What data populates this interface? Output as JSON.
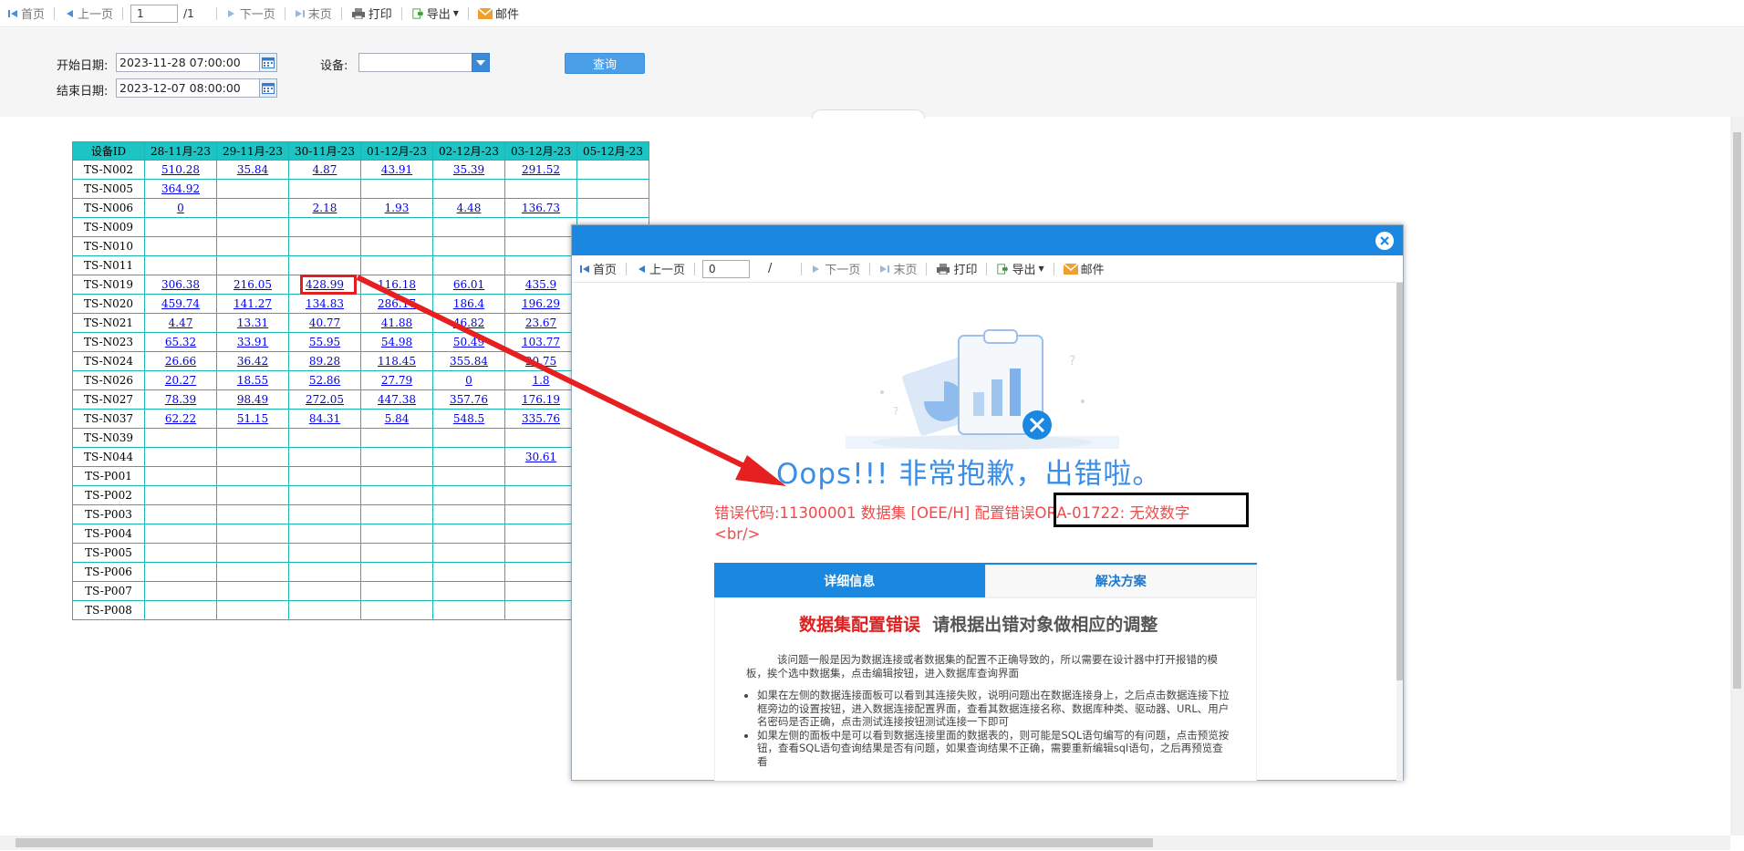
{
  "toolbar": {
    "first": "首页",
    "prev": "上一页",
    "page_value": "1",
    "page_total": "/1",
    "next": "下一页",
    "last": "末页",
    "print": "打印",
    "export": "导出",
    "mail": "邮件"
  },
  "filter": {
    "start_label": "开始日期:",
    "start_value": "2023-11-28 07:00:00",
    "end_label": "结束日期:",
    "end_value": "2023-12-07 08:00:00",
    "device_label": "设备:",
    "device_value": "",
    "query_button": "查询"
  },
  "table": {
    "headers": [
      "设备ID",
      "28-11月-23",
      "29-11月-23",
      "30-11月-23",
      "01-12月-23",
      "02-12月-23",
      "03-12月-23",
      "05-12月-23"
    ],
    "rows": [
      [
        "TS-N002",
        "510.28",
        "35.84",
        "4.87",
        "43.91",
        "35.39",
        "291.52",
        ""
      ],
      [
        "TS-N005",
        "364.92",
        "",
        "",
        "",
        "",
        "",
        ""
      ],
      [
        "TS-N006",
        "0",
        "",
        "2.18",
        "1.93",
        "4.48",
        "136.73",
        ""
      ],
      [
        "TS-N009",
        "",
        "",
        "",
        "",
        "",
        "",
        ""
      ],
      [
        "TS-N010",
        "",
        "",
        "",
        "",
        "",
        "",
        ""
      ],
      [
        "TS-N011",
        "",
        "",
        "",
        "",
        "",
        "",
        ""
      ],
      [
        "TS-N019",
        "306.38",
        "216.05",
        "428.99",
        "116.18",
        "66.01",
        "435.9",
        ""
      ],
      [
        "TS-N020",
        "459.74",
        "141.27",
        "134.83",
        "286.17",
        "186.4",
        "196.29",
        ""
      ],
      [
        "TS-N021",
        "4.47",
        "13.31",
        "40.77",
        "41.88",
        "46.82",
        "23.67",
        ""
      ],
      [
        "TS-N023",
        "65.32",
        "33.91",
        "55.95",
        "54.98",
        "50.49",
        "103.77",
        ""
      ],
      [
        "TS-N024",
        "26.66",
        "36.42",
        "89.28",
        "118.45",
        "355.84",
        "20.75",
        ""
      ],
      [
        "TS-N026",
        "20.27",
        "18.55",
        "52.86",
        "27.79",
        "0",
        "1.8",
        ""
      ],
      [
        "TS-N027",
        "78.39",
        "98.49",
        "272.05",
        "447.38",
        "357.76",
        "176.19",
        ""
      ],
      [
        "TS-N037",
        "62.22",
        "51.15",
        "84.31",
        "5.84",
        "548.5",
        "335.76",
        ""
      ],
      [
        "TS-N039",
        "",
        "",
        "",
        "",
        "",
        "",
        ""
      ],
      [
        "TS-N044",
        "",
        "",
        "",
        "",
        "",
        "30.61",
        ""
      ],
      [
        "TS-P001",
        "",
        "",
        "",
        "",
        "",
        "",
        ""
      ],
      [
        "TS-P002",
        "",
        "",
        "",
        "",
        "",
        "",
        ""
      ],
      [
        "TS-P003",
        "",
        "",
        "",
        "",
        "",
        "",
        ""
      ],
      [
        "TS-P004",
        "",
        "",
        "",
        "",
        "",
        "",
        ""
      ],
      [
        "TS-P005",
        "",
        "",
        "",
        "",
        "",
        "",
        ""
      ],
      [
        "TS-P006",
        "",
        "",
        "",
        "",
        "",
        "",
        ""
      ],
      [
        "TS-P007",
        "",
        "",
        "",
        "",
        "",
        "",
        ""
      ],
      [
        "TS-P008",
        "",
        "",
        "",
        "",
        "",
        "",
        ""
      ]
    ]
  },
  "dialog": {
    "toolbar": {
      "first": "首页",
      "prev": "上一页",
      "page_value": "0",
      "page_total": "/",
      "next": "下一页",
      "last": "末页",
      "print": "打印",
      "export": "导出",
      "mail": "邮件"
    },
    "oops": "Oops!!! 非常抱歉，出错啦。",
    "error_line1": "错误代码:11300001 数据集 [OEE/H] 配置错误ORA-01722: 无效数字",
    "error_line2": "<br/>",
    "tab_details": "详细信息",
    "tab_solution": "解决方案",
    "panel_title_red": "数据集配置错误",
    "panel_title_gray": "请根据出错对象做相应的调整",
    "panel_intro": "该问题一般是因为数据连接或者数据集的配置不正确导致的，所以需要在设计器中打开报错的模板，挨个选中数据集，点击编辑按钮，进入数据库查询界面",
    "panel_item1": "如果在左侧的数据连接面板可以看到其连接失败，说明问题出在数据连接身上，之后点击数据连接下拉框旁边的设置按钮，进入数据连接配置界面，查看其数据连接名称、数据库种类、驱动器、URL、用户名密码是否正确，点击测试连接按钮测试连接一下即可",
    "panel_item2": "如果左侧的面板中是可以看到数据连接里面的数据表的，则可能是SQL语句编写的有问题，点击预览按钮，查看SQL语句查询结果是否有问题，如果查询结果不正确，需要重新编辑sql语句，之后再预览查看"
  },
  "colors": {
    "accent": "#1a88e0",
    "header_cyan": "#1cc4c4",
    "error_red": "#f04a4a",
    "annotation_red": "#e02020"
  }
}
